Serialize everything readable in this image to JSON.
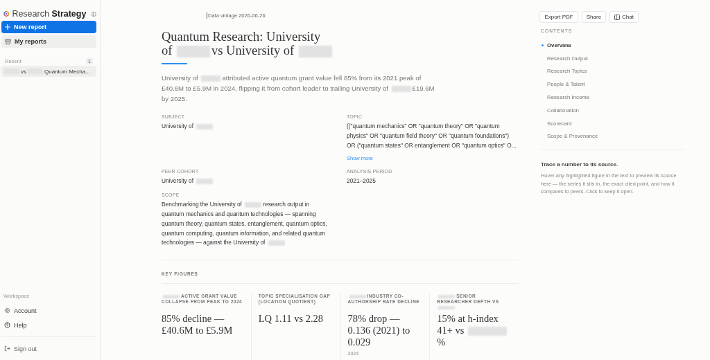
{
  "sidebar": {
    "brand": "Research **Strategy**",
    "new_report": "New report",
    "my_reports": "My reports",
    "recent_label": "Recent",
    "recent_count": "1",
    "recent_items": [
      {
        "parts": [
          {
            "kind": "redacted"
          },
          {
            "kind": "text",
            "t": "vs"
          },
          {
            "kind": "redacted"
          },
          {
            "kind": "text",
            "t": "Quantum Mecha..."
          }
        ]
      }
    ],
    "workspace_label": "Workspace",
    "workspace_items": [
      {
        "kind": "account",
        "label": "Account"
      },
      {
        "kind": "help",
        "label": "Help"
      }
    ],
    "sign_out": "Sign out"
  },
  "data_vintage": "Data vintage 2026-06-26",
  "toolbar": [
    {
      "kind": "plain",
      "label": "Export PDF"
    },
    {
      "kind": "plain",
      "label": "Share"
    },
    {
      "kind": "chat",
      "label": "Chat"
    }
  ],
  "report": {
    "title_lines": [
      [
        {
          "kind": "text",
          "t": "Quantum Research: University"
        }
      ],
      [
        {
          "kind": "text",
          "t": "of"
        },
        {
          "kind": "redacted"
        },
        {
          "kind": "text",
          "t": "vs University of"
        },
        {
          "kind": "redacted"
        }
      ]
    ],
    "summary": [
      {
        "kind": "text",
        "t": "University of"
      },
      {
        "kind": "redacted"
      },
      {
        "kind": "text",
        "t": "attributed active quantum grant value fell 85% from its 2021 peak of £40.6M to £5.9M in 2024, flipping it from cohort leader to trailing University of"
      },
      {
        "kind": "redacted"
      },
      {
        "kind": "text",
        "t": "£19.6M by 2025."
      }
    ],
    "meta": [
      {
        "label": "SUBJECT",
        "value": [
          {
            "kind": "text",
            "t": "University of"
          },
          {
            "kind": "redacted"
          }
        ]
      },
      {
        "label": "TOPIC",
        "value": [
          {
            "kind": "text",
            "t": "((\"quantum mechanics\" OR \"quantum theory\" OR \"quantum physics\" OR \"quantum field theory\" OR \"quantum foundations\") OR (\"quantum states\" OR entanglement OR \"quantum optics\" O..."
          }
        ],
        "link": "Show more"
      },
      {
        "label": "PEER COHORT",
        "value": [
          {
            "kind": "text",
            "t": "University of"
          },
          {
            "kind": "redacted"
          }
        ]
      },
      {
        "label": "ANALYSIS PERIOD",
        "value": [
          {
            "kind": "text",
            "t": "2021–2025"
          }
        ]
      },
      {
        "label": "SCOPE",
        "value": [
          {
            "kind": "text",
            "t": "Benchmarking the University of"
          },
          {
            "kind": "redacted"
          },
          {
            "kind": "text",
            "t": "research output in quantum mechanics and quantum technologies — spanning quantum theory, quantum states, entanglement, quantum optics, quantum computing, quantum information, and related quantum technologies — against the University of"
          },
          {
            "kind": "redacted"
          }
        ]
      }
    ],
    "key_figures_label": "KEY FIGURES",
    "key_figures": [
      {
        "label": [
          {
            "kind": "redacted"
          },
          {
            "kind": "text",
            "t": "ACTIVE GRANT VALUE COLLAPSE FROM PEAK TO 2024"
          }
        ],
        "value": [
          {
            "kind": "text",
            "t": "85% decline — £40.6M to £5.9M"
          }
        ]
      },
      {
        "label": [
          {
            "kind": "text",
            "t": "TOPIC SPECIALISATION GAP (LOCATION QUOTIENT)"
          }
        ],
        "value": [
          {
            "kind": "text",
            "t": "LQ 1.11 vs 2.28"
          }
        ]
      },
      {
        "label": [
          {
            "kind": "redacted"
          },
          {
            "kind": "text",
            "t": "INDUSTRY CO-AUTHORSHIP RATE DECLINE"
          }
        ],
        "value": [
          {
            "kind": "text",
            "t": "78% drop — 0.136 (2021) to 0.029"
          }
        ],
        "note": "2024"
      },
      {
        "label": [
          {
            "kind": "redacted"
          },
          {
            "kind": "text",
            "t": "SENIOR RESEARCHER DEPTH VS"
          },
          {
            "kind": "redacted"
          }
        ],
        "value": [
          {
            "kind": "text",
            "t": "15% at h-index 41+ vs"
          },
          {
            "kind": "redacted"
          },
          {
            "kind": "text",
            "t": "%"
          }
        ]
      }
    ]
  },
  "contents": {
    "label": "CONTENTS",
    "items": [
      {
        "label": "Overview",
        "selected": true
      },
      {
        "label": "Research Output",
        "selected": false
      },
      {
        "label": "Research Topics",
        "selected": false
      },
      {
        "label": "People & Talent",
        "selected": false
      },
      {
        "label": "Research Income",
        "selected": false
      },
      {
        "label": "Collaboration",
        "selected": false
      },
      {
        "label": "Scorecard",
        "selected": false
      },
      {
        "label": "Scope & Provenance",
        "selected": false
      }
    ]
  },
  "trace": {
    "title": "Trace a number to its source.",
    "body": "Hover any highlighted figure in the text to preview its source here — the series it sits in, the exact cited point, and how it compares to peers. Click to keep it open."
  }
}
